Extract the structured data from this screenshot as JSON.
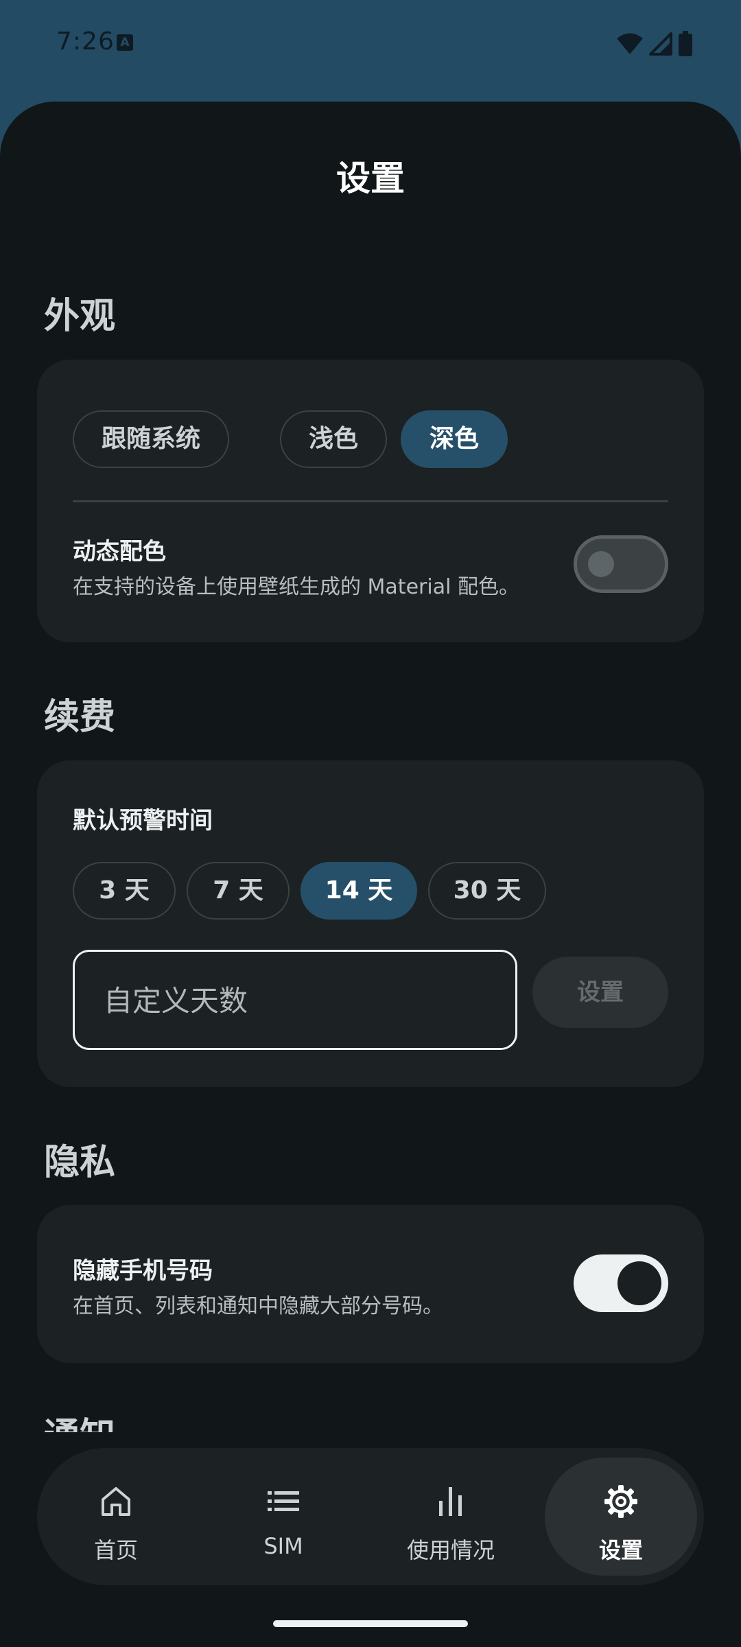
{
  "status_bar": {
    "time": "7:26",
    "a_icon": "A"
  },
  "page": {
    "title": "设置"
  },
  "appearance": {
    "section_title": "外观",
    "theme_options": [
      "跟随系统",
      "浅色",
      "深色"
    ],
    "selected_theme": "深色",
    "dynamic_color_title": "动态配色",
    "dynamic_color_desc": "在支持的设备上使用壁纸生成的 Material 配色。",
    "dynamic_color_enabled": false
  },
  "renewal": {
    "section_title": "续费",
    "default_warning_label": "默认预警时间",
    "day_options": [
      "3 天",
      "7 天",
      "14 天",
      "30 天"
    ],
    "selected_days": "14 天",
    "custom_days_placeholder": "自定义天数",
    "custom_days_value": "",
    "set_button_label": "设置"
  },
  "privacy": {
    "section_title": "隐私",
    "hide_number_title": "隐藏手机号码",
    "hide_number_desc": "在首页、列表和通知中隐藏大部分号码。",
    "hide_number_enabled": true
  },
  "notifications": {
    "section_title": "通知"
  },
  "bottom_nav": {
    "items": [
      {
        "label": "首页",
        "icon": "home-icon"
      },
      {
        "label": "SIM",
        "icon": "list-icon"
      },
      {
        "label": "使用情况",
        "icon": "bar-chart-icon"
      },
      {
        "label": "设置",
        "icon": "gear-icon"
      }
    ],
    "active": "设置"
  },
  "colors": {
    "accent": "#265069",
    "background": "#111618",
    "card": "#1c2123",
    "status_bar": "#234b63"
  }
}
